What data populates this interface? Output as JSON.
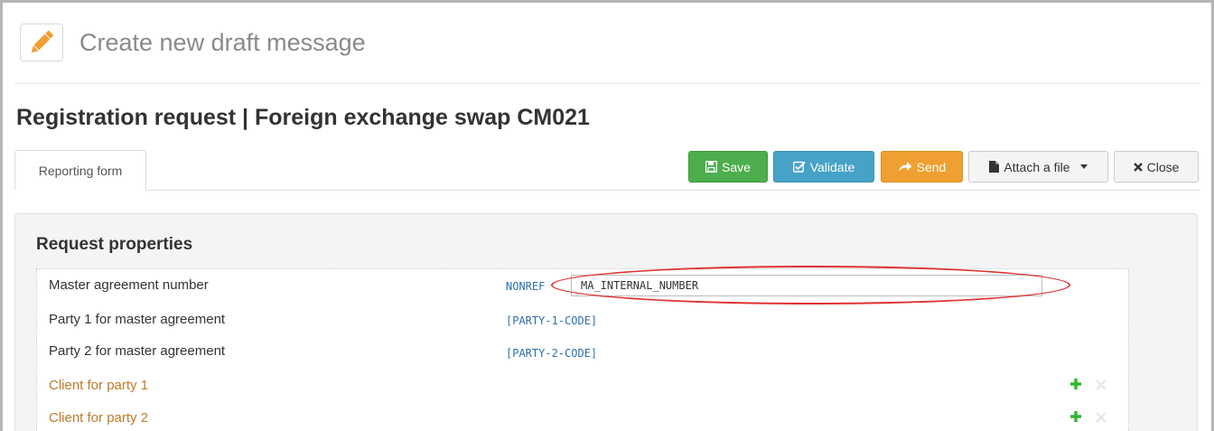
{
  "header": {
    "title": "Create new draft message",
    "icon": "pencil-icon"
  },
  "main": {
    "title": "Registration request | Foreign exchange swap CM021"
  },
  "tabs": [
    {
      "label": "Reporting form",
      "active": true
    }
  ],
  "toolbar": {
    "save_label": "Save",
    "validate_label": "Validate",
    "send_label": "Send",
    "attach_label": "Attach a file",
    "close_label": "Close",
    "colors": {
      "save": "#4cae4c",
      "validate": "#46a2c6",
      "send": "#f0a030"
    }
  },
  "panel": {
    "title": "Request properties",
    "rows": [
      {
        "label": "Master agreement number",
        "code": "NONREF",
        "value": "MA_INTERNAL_NUMBER",
        "optional": false
      },
      {
        "label": "Party 1 for master agreement",
        "code": "[PARTY-1-CODE]",
        "optional": false
      },
      {
        "label": "Party 2 for master agreement",
        "code": "[PARTY-2-CODE]",
        "optional": false
      },
      {
        "label": "Client for party 1",
        "optional": true,
        "actions": [
          "plus-icon",
          "remove-icon"
        ]
      },
      {
        "label": "Client for party 2",
        "optional": true,
        "actions": [
          "plus-icon",
          "remove-icon"
        ]
      }
    ]
  }
}
